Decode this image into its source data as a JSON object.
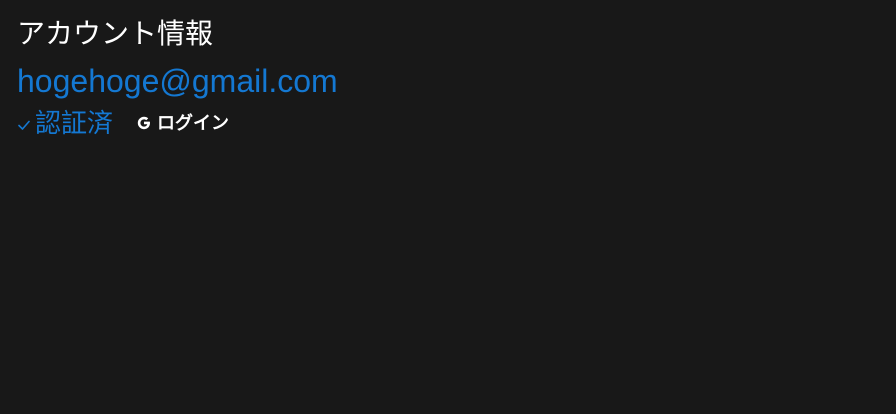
{
  "account": {
    "title": "アカウント情報",
    "email": "hogehoge@gmail.com",
    "verified_label": "認証済",
    "provider_label": "ログイン"
  },
  "colors": {
    "background": "#181818",
    "accent": "#1478d2",
    "text": "#ffffff"
  },
  "icons": {
    "verified": "check-icon",
    "provider": "google-icon"
  }
}
